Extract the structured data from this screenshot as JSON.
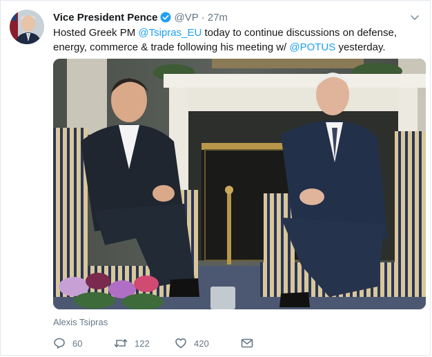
{
  "tweet": {
    "author_name": "Vice President Pence",
    "handle": "@VP",
    "separator": "·",
    "time": "27m",
    "text_parts": {
      "t1": "Hosted Greek PM ",
      "m1": "@Tsipras_EU",
      "t2": " today to continue discussions on defense, energy, commerce & trade following his meeting w/ ",
      "m2": "@POTUS",
      "t3": " yesterday."
    },
    "media_caption": "Alexis Tsipras",
    "counts": {
      "replies": "60",
      "retweets": "122",
      "likes": "420"
    }
  },
  "icons": {
    "verified": "verified-badge-icon",
    "menu": "chevron-down-icon",
    "reply": "reply-icon",
    "retweet": "retweet-icon",
    "like": "heart-icon",
    "dm": "envelope-icon"
  },
  "colors": {
    "accent": "#1da1f2",
    "text": "#14171a",
    "muted": "#657786"
  }
}
